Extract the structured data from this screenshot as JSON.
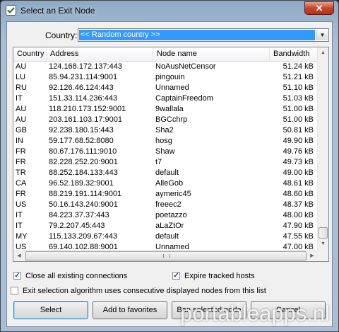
{
  "window": {
    "title": "Select an Exit Node",
    "close_label": "✕"
  },
  "country": {
    "label": "Country:",
    "selected": "<< Random country >>"
  },
  "table": {
    "columns": [
      "Country",
      "Address",
      "Node name",
      "Bandwidth"
    ],
    "rows": [
      [
        "AU",
        "124.168.172.137:443",
        "NoAusNetCensor",
        "51.24 kB"
      ],
      [
        "LU",
        "85.94.231.114:9001",
        "pingouin",
        "51.21 kB"
      ],
      [
        "RU",
        "92.126.46.124:443",
        "Unnamed",
        "51.10 kB"
      ],
      [
        "IT",
        "151.33.114.236:443",
        "CaptainFreedom",
        "51.03 kB"
      ],
      [
        "AU",
        "118.210.173.152:9001",
        "9wallala",
        "51.00 kB"
      ],
      [
        "AU",
        "203.161.103.17:9001",
        "BGCchrp",
        "51.00 kB"
      ],
      [
        "GB",
        "92.238.180.15:443",
        "Sha2",
        "50.81 kB"
      ],
      [
        "IN",
        "59.177.68.52:8080",
        "hosg",
        "49.90 kB"
      ],
      [
        "FR",
        "80.67.176.111:9010",
        "Shaw",
        "49.76 kB"
      ],
      [
        "FR",
        "82.228.252.20:9001",
        "t7",
        "49.73 kB"
      ],
      [
        "TR",
        "88.252.184.133:443",
        "default",
        "49.00 kB"
      ],
      [
        "CA",
        "96.52.189.32:9001",
        "AlleGob",
        "48.61 kB"
      ],
      [
        "FR",
        "88.219.191.114:9001",
        "aymeric45",
        "48.60 kB"
      ],
      [
        "US",
        "50.16.143.240:9001",
        "freeec2",
        "48.37 kB"
      ],
      [
        "IT",
        "84.223.37.37:443",
        "poetazzo",
        "48.00 kB"
      ],
      [
        "IT",
        "79.2.207.45:443",
        "aLaZtOr",
        "47.90 kB"
      ],
      [
        "MY",
        "115.133.209.67:443",
        "default",
        "47.55 kB"
      ],
      [
        "US",
        "69.140.102.88:9001",
        "Unnamed",
        "47.00 kB"
      ]
    ]
  },
  "options": {
    "close_connections": {
      "label": "Close all existing connections",
      "checked": true
    },
    "expire_hosts": {
      "label": "Expire tracked hosts",
      "checked": true
    },
    "consecutive_nodes": {
      "label": "Exit selection algorithm uses consecutive displayed nodes from this list",
      "checked": false
    }
  },
  "buttons": {
    "select": "Select",
    "add_favorites": "Add to favorites",
    "ban_node": "Ban selected node",
    "cancel": "Cancel"
  },
  "watermark": "portableapps.nl"
}
